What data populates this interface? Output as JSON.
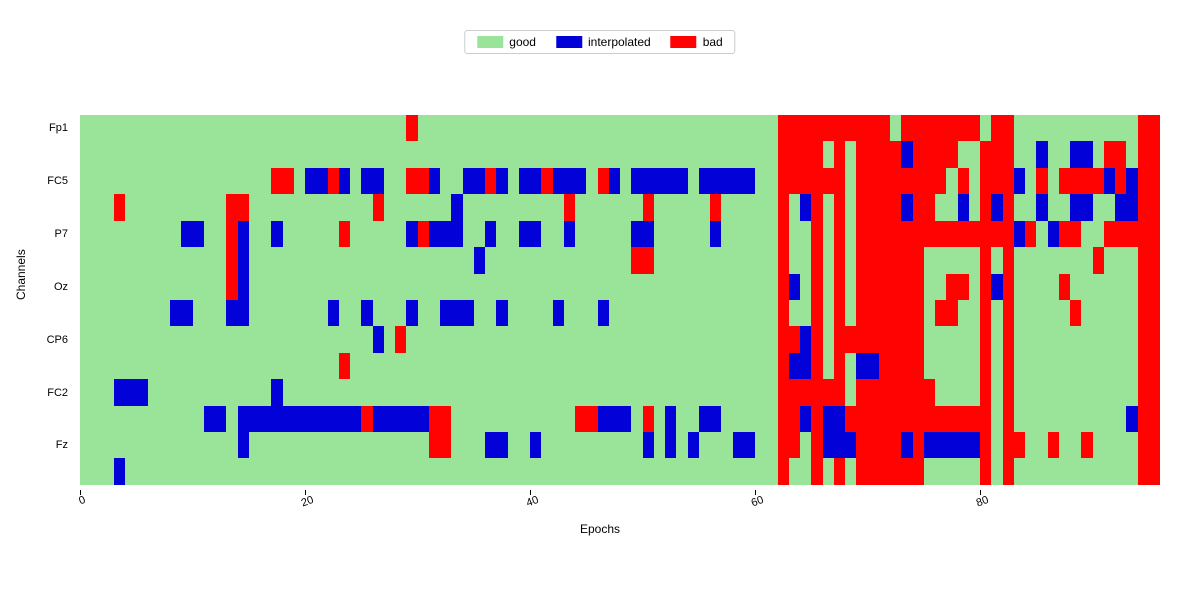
{
  "legend": {
    "good": "good",
    "interpolated": "interpolated",
    "bad": "bad"
  },
  "colors": {
    "good": "#99e499",
    "interpolated": "#0202d8",
    "bad": "#ff0303"
  },
  "chart_data": {
    "type": "heatmap",
    "xlabel": "Epochs",
    "ylabel": "Channels",
    "title": "",
    "x": {
      "min": 0,
      "max": 96,
      "ticks": [
        0,
        20,
        40,
        60,
        80
      ]
    },
    "y_channels": [
      "Fp1",
      "",
      "FC5",
      "",
      "P7",
      "",
      "Oz",
      "",
      "CP6",
      "",
      "FC2",
      "",
      "Fz",
      ""
    ],
    "categories": [
      "good",
      "interpolated",
      "bad"
    ],
    "legend_position": "top-center",
    "note": "cell values: 0=good,1=interpolated,2=bad",
    "matrix": [
      [
        0,
        0,
        0,
        0,
        0,
        0,
        0,
        0,
        0,
        0,
        0,
        0,
        0,
        0,
        0,
        0,
        0,
        0,
        0,
        0,
        0,
        0,
        0,
        0,
        0,
        0,
        0,
        0,
        0,
        2,
        0,
        0,
        0,
        0,
        0,
        0,
        0,
        0,
        0,
        0,
        0,
        0,
        0,
        0,
        0,
        0,
        0,
        0,
        0,
        0,
        0,
        0,
        0,
        0,
        0,
        0,
        0,
        0,
        0,
        0,
        0,
        0,
        2,
        2,
        2,
        2,
        2,
        2,
        2,
        2,
        2,
        2,
        0,
        2,
        2,
        2,
        2,
        2,
        2,
        2,
        0,
        2,
        2,
        0,
        0,
        0,
        0,
        0,
        0,
        0,
        0,
        0,
        0,
        0,
        2,
        2
      ],
      [
        0,
        0,
        0,
        0,
        0,
        0,
        0,
        0,
        0,
        0,
        0,
        0,
        0,
        0,
        0,
        0,
        0,
        0,
        0,
        0,
        0,
        0,
        0,
        0,
        0,
        0,
        0,
        0,
        0,
        0,
        0,
        0,
        0,
        0,
        0,
        0,
        0,
        0,
        0,
        0,
        0,
        0,
        0,
        0,
        0,
        0,
        0,
        0,
        0,
        0,
        0,
        0,
        0,
        0,
        0,
        0,
        0,
        0,
        0,
        0,
        0,
        0,
        2,
        2,
        2,
        2,
        0,
        2,
        0,
        2,
        2,
        2,
        2,
        1,
        2,
        2,
        2,
        2,
        0,
        0,
        2,
        2,
        2,
        0,
        0,
        1,
        0,
        0,
        1,
        1,
        0,
        2,
        2,
        0,
        2,
        2
      ],
      [
        0,
        0,
        0,
        0,
        0,
        0,
        0,
        0,
        0,
        0,
        0,
        0,
        0,
        0,
        0,
        0,
        0,
        2,
        2,
        0,
        1,
        1,
        2,
        1,
        0,
        1,
        1,
        0,
        0,
        2,
        2,
        1,
        0,
        0,
        1,
        1,
        2,
        1,
        0,
        1,
        1,
        2,
        1,
        1,
        1,
        0,
        2,
        1,
        0,
        1,
        1,
        1,
        1,
        1,
        0,
        1,
        1,
        1,
        1,
        1,
        0,
        0,
        2,
        2,
        2,
        2,
        2,
        2,
        0,
        2,
        2,
        2,
        2,
        2,
        2,
        2,
        2,
        0,
        2,
        0,
        2,
        2,
        2,
        1,
        0,
        2,
        0,
        2,
        2,
        2,
        2,
        1,
        2,
        1,
        2,
        2
      ],
      [
        0,
        0,
        0,
        2,
        0,
        0,
        0,
        0,
        0,
        0,
        0,
        0,
        0,
        2,
        2,
        0,
        0,
        0,
        0,
        0,
        0,
        0,
        0,
        0,
        0,
        0,
        2,
        0,
        0,
        0,
        0,
        0,
        0,
        1,
        0,
        0,
        0,
        0,
        0,
        0,
        0,
        0,
        0,
        2,
        0,
        0,
        0,
        0,
        0,
        0,
        2,
        0,
        0,
        0,
        0,
        0,
        2,
        0,
        0,
        0,
        0,
        0,
        2,
        0,
        1,
        2,
        0,
        2,
        0,
        2,
        2,
        2,
        2,
        1,
        2,
        2,
        0,
        0,
        1,
        0,
        2,
        1,
        2,
        0,
        0,
        1,
        0,
        0,
        1,
        1,
        0,
        0,
        1,
        1,
        2,
        2
      ],
      [
        0,
        0,
        0,
        0,
        0,
        0,
        0,
        0,
        0,
        1,
        1,
        0,
        0,
        2,
        1,
        0,
        0,
        1,
        0,
        0,
        0,
        0,
        0,
        2,
        0,
        0,
        0,
        0,
        0,
        1,
        2,
        1,
        1,
        1,
        0,
        0,
        1,
        0,
        0,
        1,
        1,
        0,
        0,
        1,
        0,
        0,
        0,
        0,
        0,
        1,
        1,
        0,
        0,
        0,
        0,
        0,
        1,
        0,
        0,
        0,
        0,
        0,
        2,
        0,
        0,
        2,
        0,
        2,
        0,
        2,
        2,
        2,
        2,
        2,
        2,
        2,
        2,
        2,
        2,
        2,
        2,
        2,
        2,
        1,
        2,
        0,
        1,
        2,
        2,
        0,
        0,
        2,
        2,
        2,
        2,
        2
      ],
      [
        0,
        0,
        0,
        0,
        0,
        0,
        0,
        0,
        0,
        0,
        0,
        0,
        0,
        2,
        1,
        0,
        0,
        0,
        0,
        0,
        0,
        0,
        0,
        0,
        0,
        0,
        0,
        0,
        0,
        0,
        0,
        0,
        0,
        0,
        0,
        1,
        0,
        0,
        0,
        0,
        0,
        0,
        0,
        0,
        0,
        0,
        0,
        0,
        0,
        2,
        2,
        0,
        0,
        0,
        0,
        0,
        0,
        0,
        0,
        0,
        0,
        0,
        2,
        0,
        0,
        2,
        0,
        2,
        0,
        2,
        2,
        2,
        2,
        2,
        2,
        0,
        0,
        0,
        0,
        0,
        2,
        0,
        2,
        0,
        0,
        0,
        0,
        0,
        0,
        0,
        2,
        0,
        0,
        0,
        2,
        2
      ],
      [
        0,
        0,
        0,
        0,
        0,
        0,
        0,
        0,
        0,
        0,
        0,
        0,
        0,
        2,
        1,
        0,
        0,
        0,
        0,
        0,
        0,
        0,
        0,
        0,
        0,
        0,
        0,
        0,
        0,
        0,
        0,
        0,
        0,
        0,
        0,
        0,
        0,
        0,
        0,
        0,
        0,
        0,
        0,
        0,
        0,
        0,
        0,
        0,
        0,
        0,
        0,
        0,
        0,
        0,
        0,
        0,
        0,
        0,
        0,
        0,
        0,
        0,
        2,
        1,
        0,
        2,
        0,
        2,
        0,
        2,
        2,
        2,
        2,
        2,
        2,
        0,
        0,
        2,
        2,
        0,
        2,
        1,
        2,
        0,
        0,
        0,
        0,
        2,
        0,
        0,
        0,
        0,
        0,
        0,
        2,
        2
      ],
      [
        0,
        0,
        0,
        0,
        0,
        0,
        0,
        0,
        1,
        1,
        0,
        0,
        0,
        1,
        1,
        0,
        0,
        0,
        0,
        0,
        0,
        0,
        1,
        0,
        0,
        1,
        0,
        0,
        0,
        1,
        0,
        0,
        1,
        1,
        1,
        0,
        0,
        1,
        0,
        0,
        0,
        0,
        1,
        0,
        0,
        0,
        1,
        0,
        0,
        0,
        0,
        0,
        0,
        0,
        0,
        0,
        0,
        0,
        0,
        0,
        0,
        0,
        2,
        0,
        0,
        2,
        0,
        2,
        0,
        2,
        2,
        2,
        2,
        2,
        2,
        0,
        2,
        2,
        0,
        0,
        2,
        0,
        2,
        0,
        0,
        0,
        0,
        0,
        2,
        0,
        0,
        0,
        0,
        0,
        2,
        2
      ],
      [
        0,
        0,
        0,
        0,
        0,
        0,
        0,
        0,
        0,
        0,
        0,
        0,
        0,
        0,
        0,
        0,
        0,
        0,
        0,
        0,
        0,
        0,
        0,
        0,
        0,
        0,
        1,
        0,
        2,
        0,
        0,
        0,
        0,
        0,
        0,
        0,
        0,
        0,
        0,
        0,
        0,
        0,
        0,
        0,
        0,
        0,
        0,
        0,
        0,
        0,
        0,
        0,
        0,
        0,
        0,
        0,
        0,
        0,
        0,
        0,
        0,
        0,
        2,
        2,
        1,
        2,
        0,
        2,
        2,
        2,
        2,
        2,
        2,
        2,
        2,
        0,
        0,
        0,
        0,
        0,
        2,
        0,
        2,
        0,
        0,
        0,
        0,
        0,
        0,
        0,
        0,
        0,
        0,
        0,
        2,
        2
      ],
      [
        0,
        0,
        0,
        0,
        0,
        0,
        0,
        0,
        0,
        0,
        0,
        0,
        0,
        0,
        0,
        0,
        0,
        0,
        0,
        0,
        0,
        0,
        0,
        2,
        0,
        0,
        0,
        0,
        0,
        0,
        0,
        0,
        0,
        0,
        0,
        0,
        0,
        0,
        0,
        0,
        0,
        0,
        0,
        0,
        0,
        0,
        0,
        0,
        0,
        0,
        0,
        0,
        0,
        0,
        0,
        0,
        0,
        0,
        0,
        0,
        0,
        0,
        2,
        1,
        1,
        2,
        0,
        2,
        0,
        1,
        1,
        2,
        2,
        2,
        2,
        0,
        0,
        0,
        0,
        0,
        2,
        0,
        2,
        0,
        0,
        0,
        0,
        0,
        0,
        0,
        0,
        0,
        0,
        0,
        2,
        2
      ],
      [
        0,
        0,
        0,
        1,
        1,
        1,
        0,
        0,
        0,
        0,
        0,
        0,
        0,
        0,
        0,
        0,
        0,
        1,
        0,
        0,
        0,
        0,
        0,
        0,
        0,
        0,
        0,
        0,
        0,
        0,
        0,
        0,
        0,
        0,
        0,
        0,
        0,
        0,
        0,
        0,
        0,
        0,
        0,
        0,
        0,
        0,
        0,
        0,
        0,
        0,
        0,
        0,
        0,
        0,
        0,
        0,
        0,
        0,
        0,
        0,
        0,
        0,
        2,
        2,
        2,
        2,
        2,
        2,
        0,
        2,
        2,
        2,
        2,
        2,
        2,
        2,
        0,
        0,
        0,
        0,
        2,
        0,
        2,
        0,
        0,
        0,
        0,
        0,
        0,
        0,
        0,
        0,
        0,
        0,
        2,
        2
      ],
      [
        0,
        0,
        0,
        0,
        0,
        0,
        0,
        0,
        0,
        0,
        0,
        1,
        1,
        0,
        1,
        1,
        1,
        1,
        1,
        1,
        1,
        1,
        1,
        1,
        1,
        2,
        1,
        1,
        1,
        1,
        1,
        2,
        2,
        0,
        0,
        0,
        0,
        0,
        0,
        0,
        0,
        0,
        0,
        0,
        2,
        2,
        1,
        1,
        1,
        0,
        2,
        0,
        1,
        0,
        0,
        1,
        1,
        0,
        0,
        0,
        0,
        0,
        2,
        2,
        1,
        2,
        1,
        1,
        2,
        2,
        2,
        2,
        2,
        2,
        2,
        2,
        2,
        2,
        2,
        2,
        2,
        0,
        2,
        0,
        0,
        0,
        0,
        0,
        0,
        0,
        0,
        0,
        0,
        1,
        2,
        2
      ],
      [
        0,
        0,
        0,
        0,
        0,
        0,
        0,
        0,
        0,
        0,
        0,
        0,
        0,
        0,
        1,
        0,
        0,
        0,
        0,
        0,
        0,
        0,
        0,
        0,
        0,
        0,
        0,
        0,
        0,
        0,
        0,
        2,
        2,
        0,
        0,
        0,
        1,
        1,
        0,
        0,
        1,
        0,
        0,
        0,
        0,
        0,
        0,
        0,
        0,
        0,
        1,
        0,
        1,
        0,
        1,
        0,
        0,
        0,
        1,
        1,
        0,
        0,
        2,
        2,
        0,
        2,
        1,
        1,
        1,
        2,
        2,
        2,
        2,
        1,
        2,
        1,
        1,
        1,
        1,
        1,
        2,
        0,
        2,
        2,
        0,
        0,
        2,
        0,
        0,
        2,
        0,
        0,
        0,
        0,
        2,
        2
      ],
      [
        0,
        0,
        0,
        1,
        0,
        0,
        0,
        0,
        0,
        0,
        0,
        0,
        0,
        0,
        0,
        0,
        0,
        0,
        0,
        0,
        0,
        0,
        0,
        0,
        0,
        0,
        0,
        0,
        0,
        0,
        0,
        0,
        0,
        0,
        0,
        0,
        0,
        0,
        0,
        0,
        0,
        0,
        0,
        0,
        0,
        0,
        0,
        0,
        0,
        0,
        0,
        0,
        0,
        0,
        0,
        0,
        0,
        0,
        0,
        0,
        0,
        0,
        2,
        0,
        0,
        2,
        0,
        2,
        0,
        2,
        2,
        2,
        2,
        2,
        2,
        0,
        0,
        0,
        0,
        0,
        2,
        0,
        2,
        0,
        0,
        0,
        0,
        0,
        0,
        0,
        0,
        0,
        0,
        0,
        2,
        2
      ]
    ]
  }
}
